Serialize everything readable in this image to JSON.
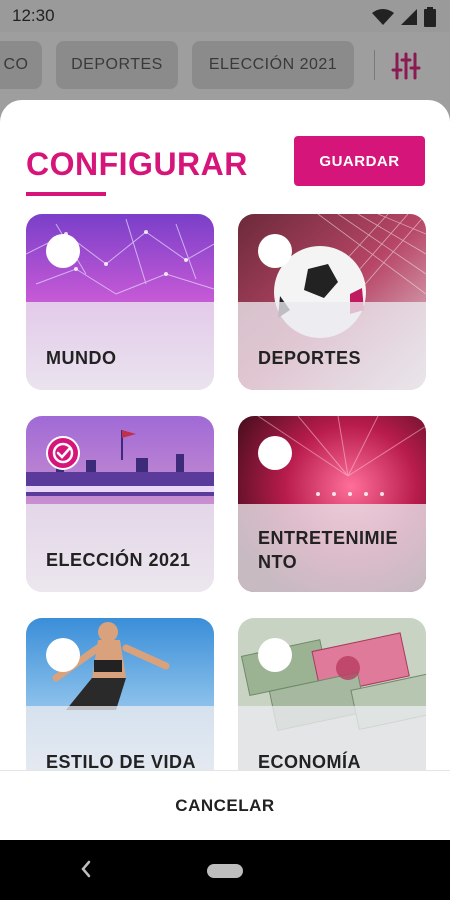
{
  "status_bar": {
    "time": "12:30"
  },
  "tabs": [
    {
      "label": "CO"
    },
    {
      "label": "DEPORTES"
    },
    {
      "label": "ELECCIÓN 2021"
    }
  ],
  "sheet": {
    "title": "CONFIGURAR",
    "save_label": "GUARDAR",
    "cancel_label": "CANCELAR"
  },
  "categories": [
    {
      "label": "MUNDO",
      "selected": false
    },
    {
      "label": "DEPORTES",
      "selected": false
    },
    {
      "label": "ELECCIÓN 2021",
      "selected": true
    },
    {
      "label": "ENTRETENIMIE NTO",
      "line1": "ENTRETENIMIE",
      "line2": "NTO",
      "selected": false
    },
    {
      "label": "ESTILO DE VIDA",
      "selected": false
    },
    {
      "label": "ECONOMÍA",
      "selected": false
    }
  ],
  "colors": {
    "accent": "#d6157a"
  }
}
